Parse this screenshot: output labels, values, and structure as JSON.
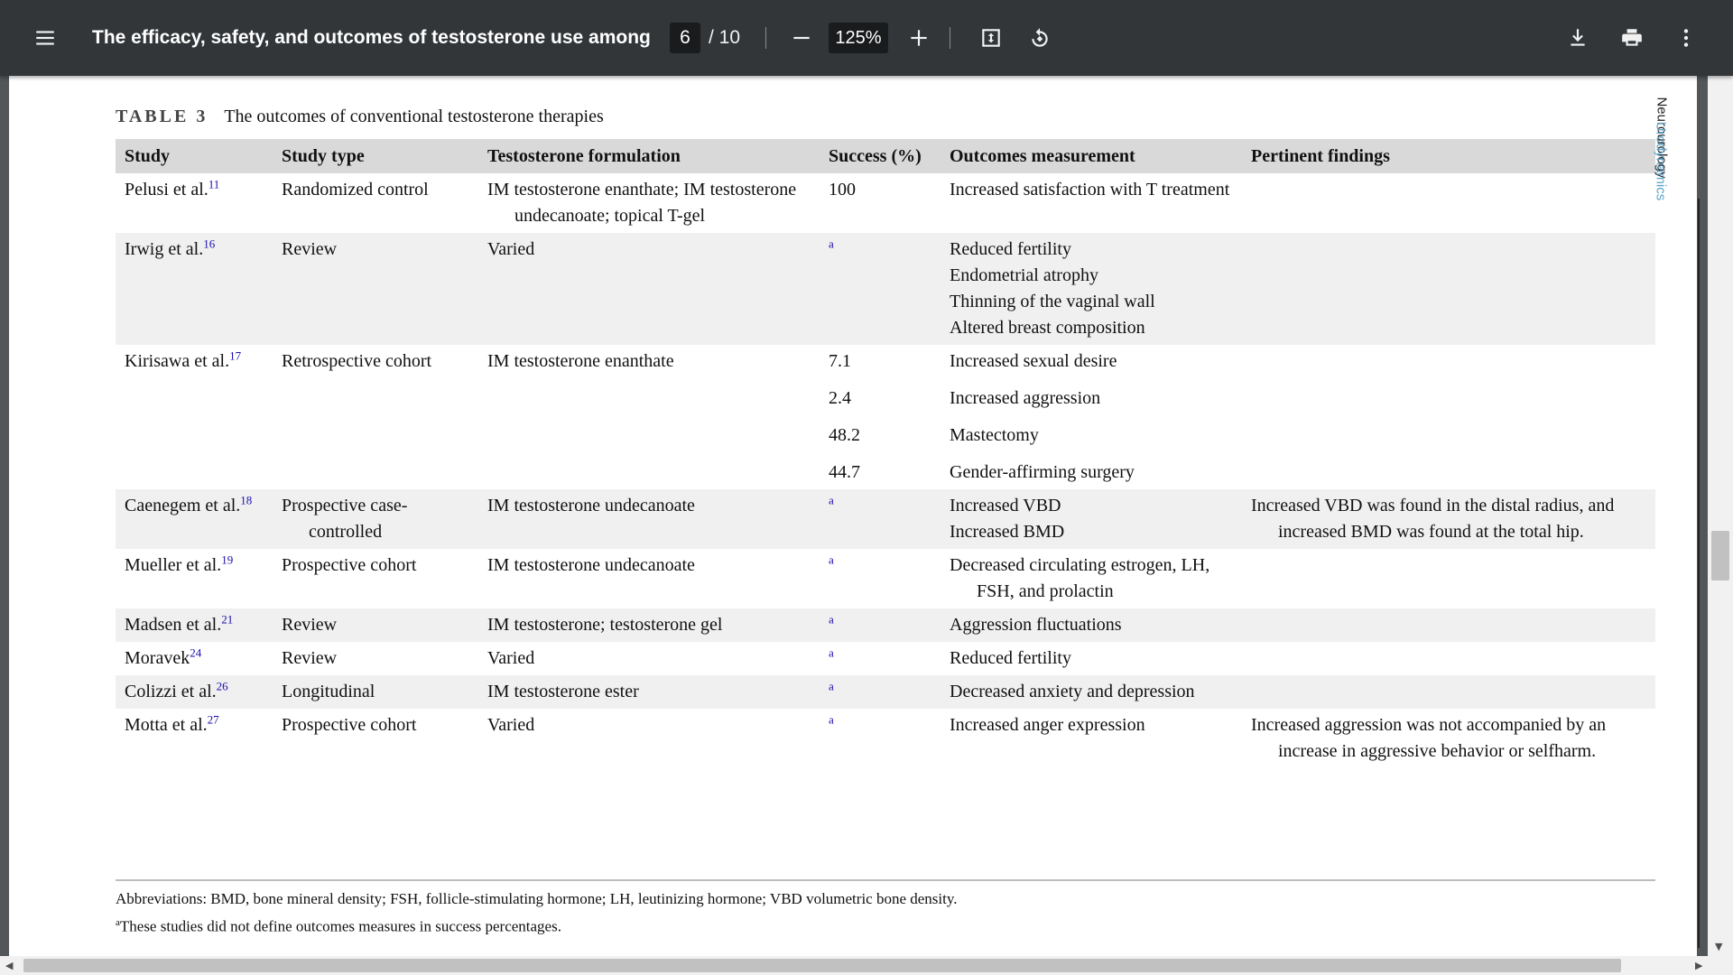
{
  "toolbar": {
    "title": "The efficacy, safety, and outcomes of testosterone use among t...",
    "page_current": "6",
    "page_total": "/ 10",
    "zoom": "125%",
    "icons": [
      "menu-icon",
      "minus-icon",
      "plus-icon",
      "fit-page-icon",
      "rotate-icon",
      "download-icon",
      "print-icon",
      "more-vert-icon"
    ]
  },
  "caption": {
    "label": "TABLE 3",
    "text": "The outcomes of conventional testosterone therapies"
  },
  "table": {
    "headers": [
      "Study",
      "Study type",
      "Testosterone formulation",
      "Success (%)",
      "Outcomes measurement",
      "Pertinent findings"
    ],
    "rows": [
      {
        "study": "Pelusi et al.",
        "ref": "11",
        "type": "Randomized control",
        "formulation": "IM testosterone enanthate; IM testosterone undecanoate; topical T-gel",
        "success": "100",
        "outcome": "Increased satisfaction with T treatment",
        "findings": ""
      },
      {
        "study": "Irwig et al.",
        "ref": "16",
        "type": "Review",
        "formulation": "Varied",
        "success_note": "a",
        "outcome_lines": [
          "Reduced fertility",
          "Endometrial atrophy",
          "Thinning of the vaginal wall",
          "Altered breast composition"
        ],
        "findings": ""
      },
      {
        "study": "Kirisawa et al.",
        "ref": "17",
        "type": "Retrospective cohort",
        "formulation": "IM testosterone enanthate",
        "success_lines": [
          "7.1",
          "2.4",
          "48.2",
          "44.7"
        ],
        "outcome_lines": [
          "Increased sexual desire",
          "Increased aggression",
          "Mastectomy",
          "Gender-affirming surgery"
        ],
        "findings": ""
      },
      {
        "study": "Caenegem et al.",
        "ref": "18",
        "type": "Prospective case-controlled",
        "formulation": "IM testosterone undecanoate",
        "success_note": "a",
        "outcome_lines": [
          "Increased VBD",
          "Increased BMD"
        ],
        "findings": "Increased VBD was found in the distal radius, and increased BMD was found at the total hip."
      },
      {
        "study": "Mueller et al.",
        "ref": "19",
        "type": "Prospective cohort",
        "formulation": "IM testosterone undecanoate",
        "success_note": "a",
        "outcome": "Decreased circulating estrogen, LH, FSH, and prolactin",
        "findings": ""
      },
      {
        "study": "Madsen et al.",
        "ref": "21",
        "type": "Review",
        "formulation": "IM testosterone; testosterone gel",
        "success_note": "a",
        "outcome": "Aggression fluctuations",
        "findings": ""
      },
      {
        "study": "Moravek",
        "ref": "24",
        "type": "Review",
        "formulation": "Varied",
        "success_note": "a",
        "outcome": "Reduced fertility",
        "findings": ""
      },
      {
        "study": "Colizzi et al.",
        "ref": "26",
        "type": "Longitudinal",
        "formulation": "IM testosterone ester",
        "success_note": "a",
        "outcome": "Decreased anxiety and depression",
        "findings": ""
      },
      {
        "study": "Motta et al.",
        "ref": "27",
        "type": "Prospective cohort",
        "formulation": "Varied",
        "success_note": "a",
        "outcome": "Increased anger expression",
        "findings": "Increased aggression was not accompanied by an increase in aggressive behavior or selfharm."
      }
    ]
  },
  "footnotes": {
    "abbreviations": "Abbreviations: BMD, bone mineral density; FSH, follicle-stimulating hormone; LH, leutinizing hormone; VBD volumetric bone density.",
    "a_marker": "a",
    "a_text": "These studies did not define outcomes measures in success percentages."
  },
  "journal": {
    "part1": "Neurourology",
    "part2": "Urodynamics"
  }
}
